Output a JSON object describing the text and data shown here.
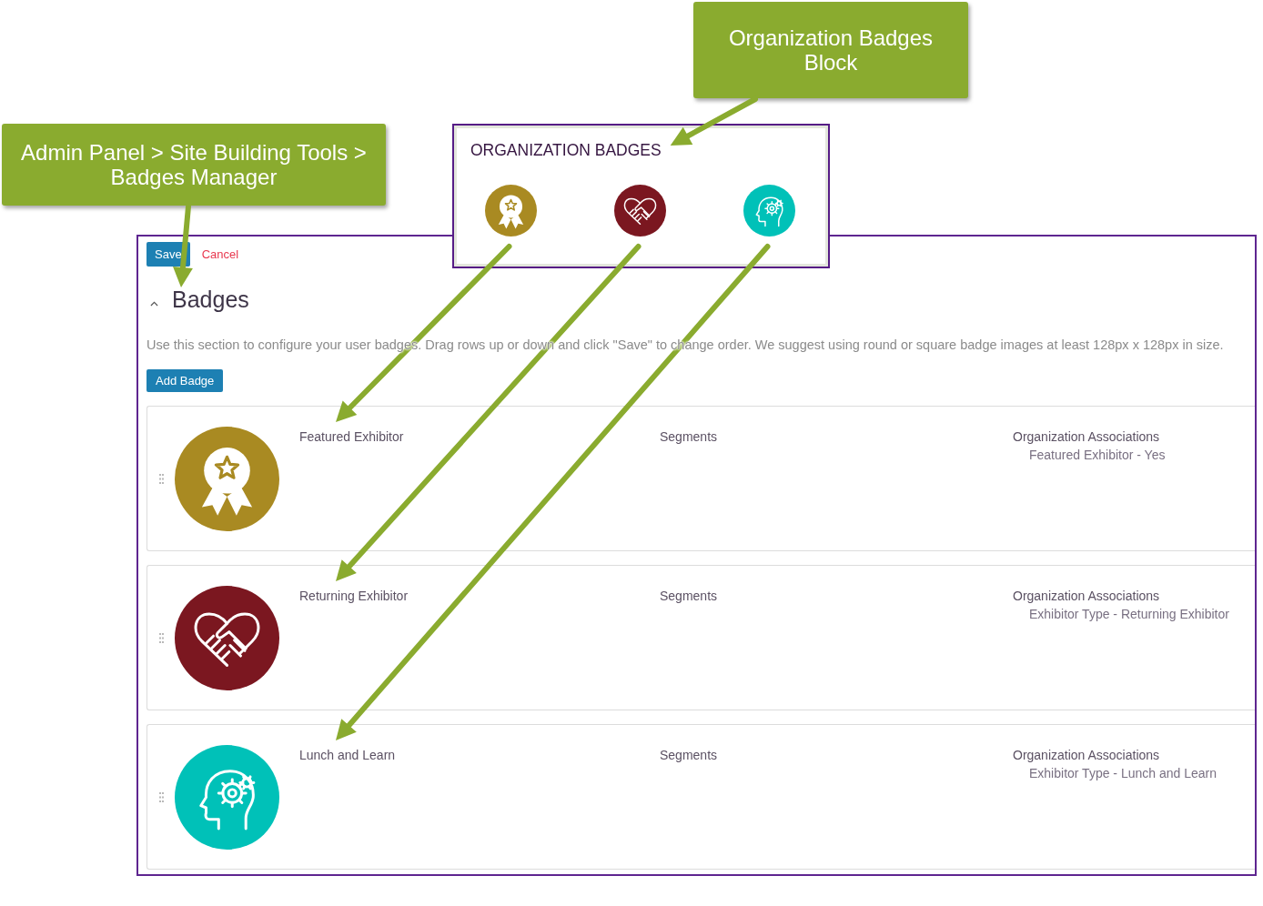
{
  "path_callout": {
    "text": "Admin Panel > Site Building Tools > Badges Manager"
  },
  "block_callout": {
    "text": "Organization Badges Block"
  },
  "organization_badges_block": {
    "title": "ORGANIZATION BADGES",
    "badges": [
      {
        "kind": "award",
        "color": "#a98a22"
      },
      {
        "kind": "handshake",
        "color": "#7b1720"
      },
      {
        "kind": "head_gear",
        "color": "#00c1b8"
      }
    ]
  },
  "badges_manager": {
    "save_button": "Save",
    "cancel_link": "Cancel",
    "section": {
      "title": "Badges",
      "expanded": true,
      "description": "Use this section to configure your user badges. Drag rows up or down and click \"Save\" to change order. We suggest using round or square badge images at least 128px x 128px in size.",
      "add_button": "Add Badge",
      "badges": [
        {
          "kind": "award",
          "color": "#a98a22",
          "name": "Featured Exhibitor",
          "segments_label": "Segments",
          "associations_label": "Organization Associations",
          "associations": [
            "Featured Exhibitor - Yes"
          ]
        },
        {
          "kind": "handshake",
          "color": "#7b1720",
          "name": "Returning Exhibitor",
          "segments_label": "Segments",
          "associations_label": "Organization Associations",
          "associations": [
            "Exhibitor Type - Returning Exhibitor"
          ]
        },
        {
          "kind": "head_gear",
          "color": "#00c1b8",
          "name": "Lunch and Learn",
          "segments_label": "Segments",
          "associations_label": "Organization Associations",
          "associations": [
            "Exhibitor Type - Lunch and Learn"
          ]
        }
      ]
    }
  }
}
